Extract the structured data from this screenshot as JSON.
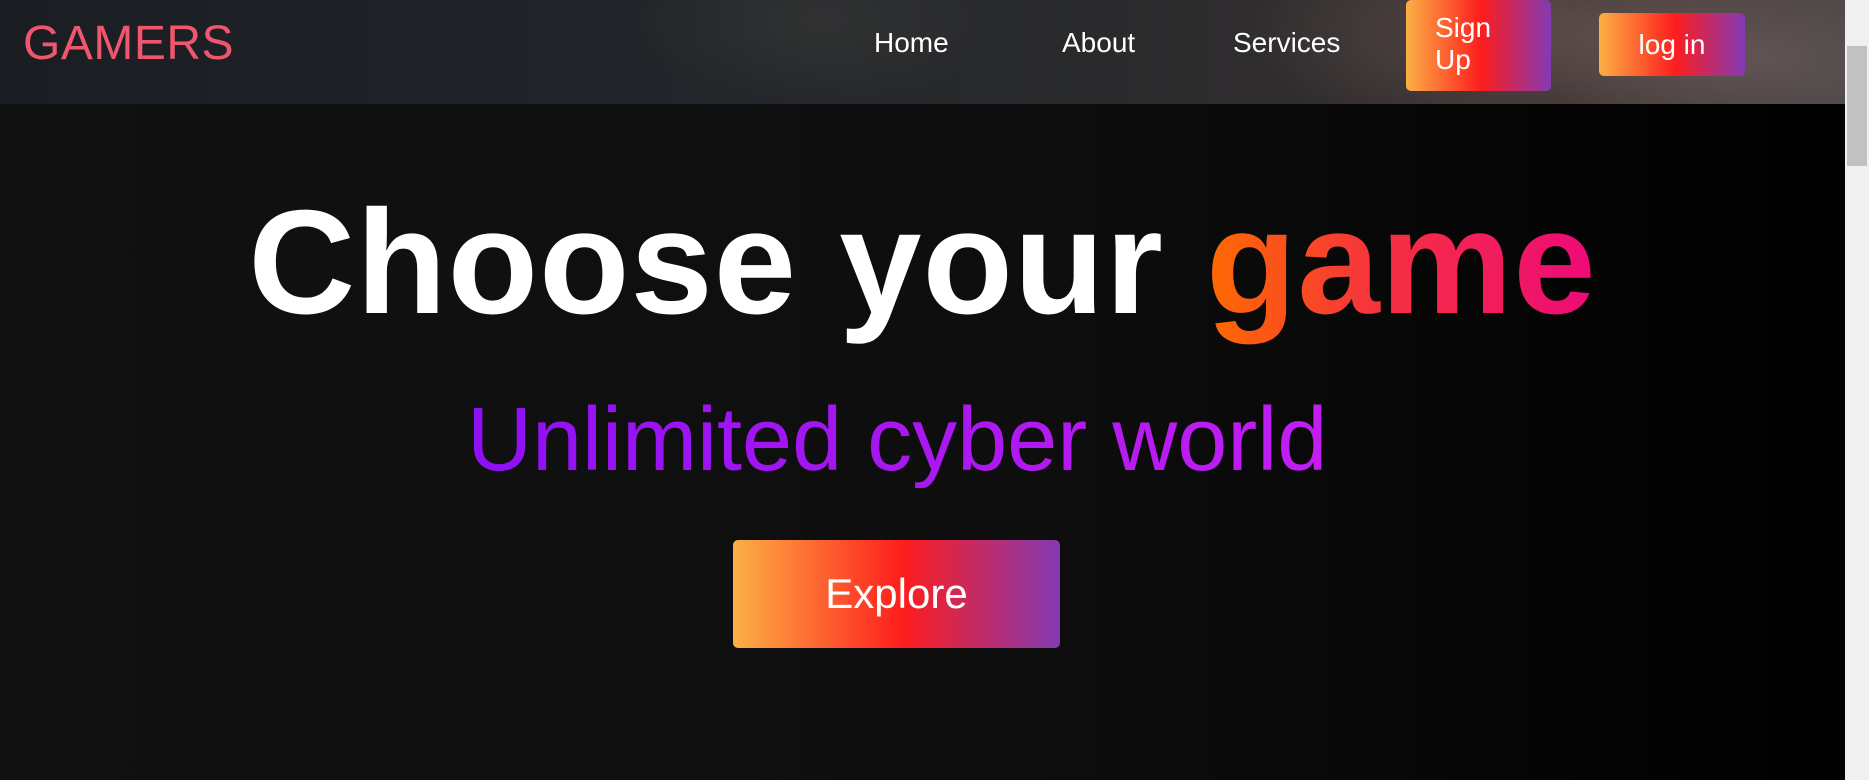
{
  "nav": {
    "logo": "GAMERS",
    "links": [
      {
        "label": "Home"
      },
      {
        "label": "About"
      },
      {
        "label": "Services"
      }
    ],
    "signup_label": "Sign Up",
    "login_label": "log in"
  },
  "hero": {
    "title_prefix": "Choose your ",
    "title_accent": "game",
    "subtitle": "Unlimited cyber world",
    "cta_label": "Explore"
  },
  "colors": {
    "logo": "#f0566e",
    "button_gradient": [
      "#fcb045",
      "#fd1d1d",
      "#833ab4"
    ],
    "title_accent_gradient": [
      "#ff6a00",
      "#ee0979"
    ],
    "subtitle_gradient": [
      "#8e10f5",
      "#c21ef2"
    ],
    "background": "#0e0e0e"
  }
}
